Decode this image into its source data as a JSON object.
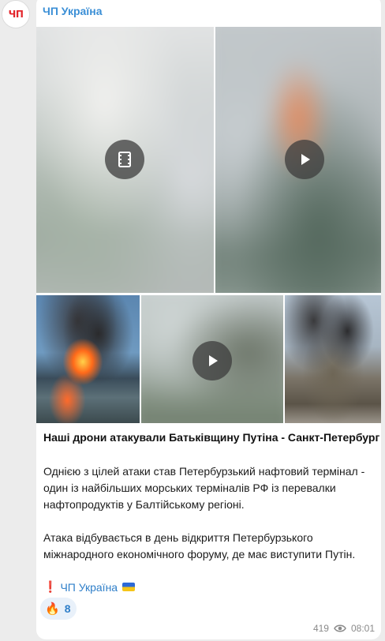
{
  "channel": {
    "name": "ЧП Україна",
    "avatar_text": "ЧП"
  },
  "media": [
    {
      "kind": "video",
      "icon": "film-icon"
    },
    {
      "kind": "video",
      "icon": "play-icon"
    },
    {
      "kind": "photo",
      "icon": ""
    },
    {
      "kind": "video",
      "icon": "play-icon"
    },
    {
      "kind": "photo",
      "icon": ""
    }
  ],
  "post": {
    "title": "Наші дрони атакували Батьківщину Путіна - Санкт-Петербург",
    "paragraph1": "Однією з цілей атаки став Петербурзький нафтовий термінал - один із найбільших морських терміналів РФ із перевалки нафтопродуктів у Балтійському регіоні.",
    "paragraph2": "Атака відбувається в день відкриття Петербурзького міжнародного економічного форуму, де має виступити Путін.",
    "signature_mark": "❗",
    "signature_link": "ЧП Україна"
  },
  "reaction": {
    "emoji": "🔥",
    "count": "8"
  },
  "meta": {
    "views": "419",
    "time": "08:01"
  },
  "colors": {
    "accent": "#3b8fd6",
    "background": "#ececec",
    "bubble": "#ffffff"
  }
}
